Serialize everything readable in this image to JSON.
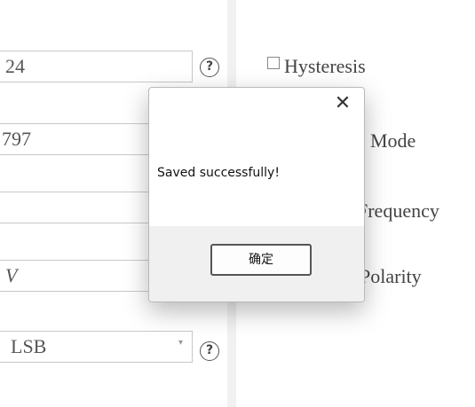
{
  "left_form": {
    "fields": [
      {
        "value": "24"
      },
      {
        "value": "797"
      },
      {
        "value": ""
      },
      {
        "value": "V"
      }
    ],
    "select": {
      "value": "LSB"
    },
    "help_glyph": "?"
  },
  "right_panel": {
    "hysteresis_label": "Hysteresis",
    "mode_label": "Mode",
    "frequency_label": "Frequency",
    "polarity_label": "Polarity"
  },
  "dialog": {
    "close_glyph": "✕",
    "message": "Saved successfully!",
    "ok_label": "确定"
  },
  "icons": [
    "help-icon",
    "close-icon",
    "checkbox",
    "dropdown-arrow-icon"
  ]
}
